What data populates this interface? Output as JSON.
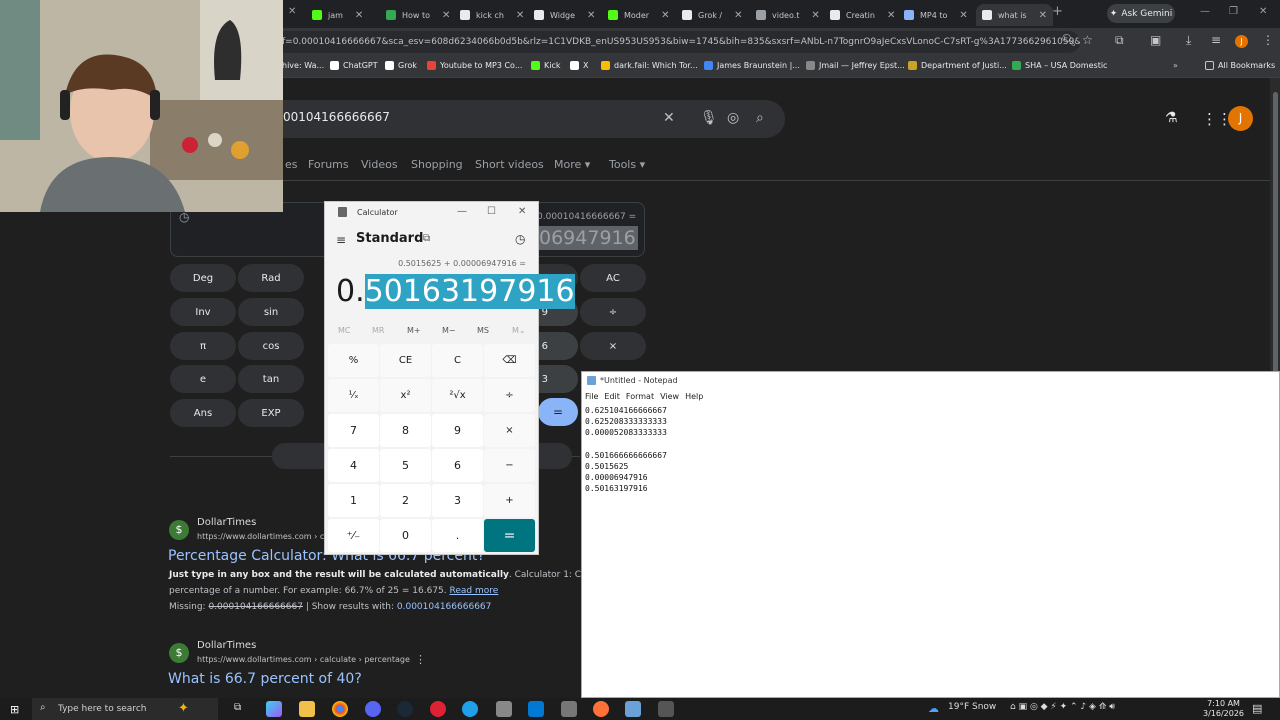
{
  "browser": {
    "tabs": [
      {
        "label": "jam",
        "color": "#53fc18"
      },
      {
        "label": "How to",
        "color": "#34a853"
      },
      {
        "label": "kick ch",
        "color": "#e8eaed"
      },
      {
        "label": "Widge",
        "color": "#e8eaed"
      },
      {
        "label": "Moder",
        "color": "#53fc18"
      },
      {
        "label": "Grok /",
        "color": "#e8eaed"
      },
      {
        "label": "video.t",
        "color": "#9aa0a6"
      },
      {
        "label": "Creatin",
        "color": "#e8eaed"
      },
      {
        "label": "MP4 to",
        "color": "#8ab4f8"
      },
      {
        "label": "what is",
        "color": "#e8eaed"
      }
    ],
    "ask_gemini": "Ask Gemini",
    "url": "f=0.00010416666667&sca_esv=608d6234066b0d5b&rlz=1C1VDKB_enUS953US953&biw=1745&bih=835&sxsrf=ANbL-n7TognrO9aJeCxsVLonoC-C7sRT-g%3A1773662961059&ei=8fK...",
    "profile_initial": "J",
    "bookmarks": [
      {
        "label": "hive: Wa...",
        "color": "#888"
      },
      {
        "label": "ChatGPT",
        "color": "#fff"
      },
      {
        "label": "Grok",
        "color": "#fff"
      },
      {
        "label": "Youtube to MP3 Co...",
        "color": "#ea4335"
      },
      {
        "label": "Kick",
        "color": "#53fc18"
      },
      {
        "label": "X",
        "color": "#fff"
      },
      {
        "label": "dark.fail: Which Tor...",
        "color": "#fbbc04"
      },
      {
        "label": "James Braunstein |...",
        "color": "#4285f4"
      },
      {
        "label": "Jmail — Jeffrey Epst...",
        "color": "#888"
      },
      {
        "label": "Department of Justi...",
        "color": "#c9a227"
      },
      {
        "label": "SHA – USA Domestic",
        "color": "#34a853"
      }
    ],
    "all_bookmarks": "All Bookmarks"
  },
  "google": {
    "query": "00104166666667",
    "nav_tabs": [
      "es",
      "Forums",
      "Videos",
      "Shopping",
      "Short videos",
      "More",
      "Tools"
    ],
    "calc_expr": "0.00010416666667 =",
    "calc_result": "06947916",
    "buttons": {
      "deg": "Deg",
      "rad": "Rad",
      "pct": "%",
      "ac": "AC",
      "inv": "Inv",
      "sin": "sin",
      "n9": "9",
      "div": "÷",
      "pi": "π",
      "cos": "cos",
      "n6": "6",
      "mul": "×",
      "e": "e",
      "tan": "tan",
      "n3": "3",
      "ans": "Ans",
      "exp": "EXP",
      "eq": "="
    },
    "results": [
      {
        "site": "DollarTimes",
        "url": "https://www.dollartimes.com › ca",
        "title": "Percentage Calculator: What is 66.7 percent?",
        "snippet_bold": "Just type in any box and the result will be calculated automatically",
        "snippet_rest": ". Calculator 1: Calculate",
        "snippet_line2": "percentage of a number. For example: 66.7% of 25 = 16.675.",
        "read_more": "Read more",
        "missing_label": "Missing:",
        "missing_value": "0.000104166666667",
        "show_with": "| Show results with:",
        "show_value": "0.000104166666667"
      },
      {
        "site": "DollarTimes",
        "url": "https://www.dollartimes.com › calculate › percentage",
        "title": "What is 66.7 percent of 40?"
      }
    ]
  },
  "calculator": {
    "title": "Calculator",
    "mode": "Standard",
    "expression": "0.5015625 + 0.00006947916 =",
    "result_prefix": "0.",
    "result_selected": "50163197916",
    "memory": [
      "MC",
      "MR",
      "M+",
      "M−",
      "MS",
      "M⌄"
    ],
    "keys": [
      [
        "%",
        "CE",
        "C",
        "⌫"
      ],
      [
        "¹⁄ₓ",
        "x²",
        "²√x",
        "÷"
      ],
      [
        "7",
        "8",
        "9",
        "×"
      ],
      [
        "4",
        "5",
        "6",
        "−"
      ],
      [
        "1",
        "2",
        "3",
        "+"
      ],
      [
        "⁺⁄₋",
        "0",
        ".",
        "="
      ]
    ]
  },
  "notepad": {
    "title": "*Untitled - Notepad",
    "menu": [
      "File",
      "Edit",
      "Format",
      "View",
      "Help"
    ],
    "lines": [
      "0.625104166666667",
      "0.625208333333333",
      "0.000052083333333",
      "",
      "0.501666666666667",
      "0.5015625",
      "0.00006947916",
      "0.50163197916"
    ]
  },
  "taskbar": {
    "search_placeholder": "Type here to search",
    "weather": "19°F  Snow",
    "time": "7:10 AM",
    "date": "3/16/2026"
  }
}
